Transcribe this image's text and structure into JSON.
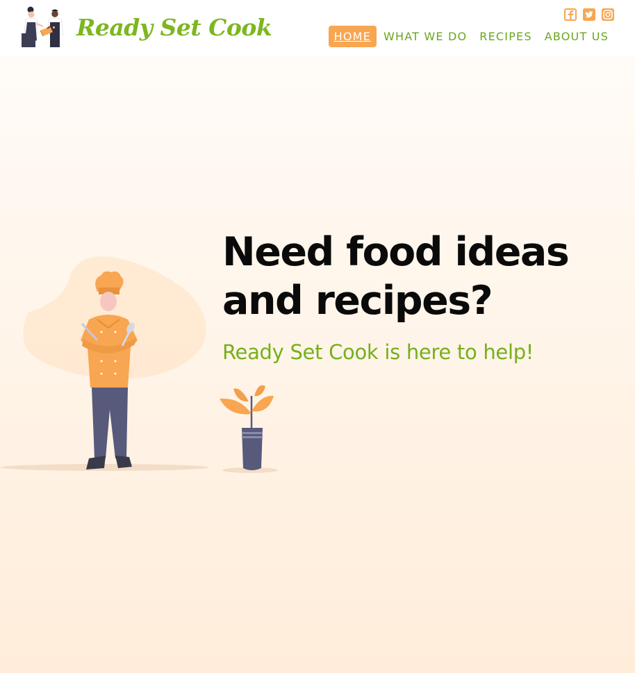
{
  "brand": {
    "name": "Ready Set Cook",
    "accent_green": "#75b01b",
    "accent_orange": "#f8a651"
  },
  "social": [
    {
      "icon": "facebook-icon"
    },
    {
      "icon": "twitter-icon"
    },
    {
      "icon": "instagram-icon"
    }
  ],
  "nav": {
    "items": [
      {
        "label": "HOME",
        "active": true
      },
      {
        "label": "WHAT WE DO",
        "active": false
      },
      {
        "label": "RECIPES",
        "active": false
      },
      {
        "label": "ABOUT US",
        "active": false
      }
    ]
  },
  "hero": {
    "headline": "Need food ideas and recipes?",
    "subhead": "Ready Set Cook is here to help!"
  }
}
